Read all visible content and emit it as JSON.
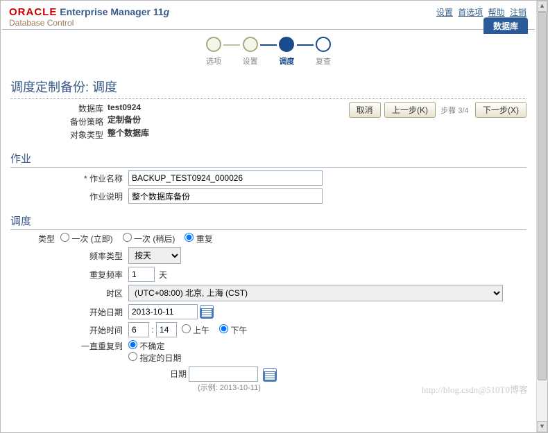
{
  "header": {
    "brand_oracle": "ORACLE",
    "brand_em": "Enterprise Manager 11",
    "brand_g": "g",
    "brand_sub": "Database Control",
    "links": {
      "settings": "设置",
      "prefs": "首选项",
      "help": "帮助",
      "logout": "注销"
    },
    "db_tab": "数据库"
  },
  "stepper": {
    "s1": "选项",
    "s2": "设置",
    "s3": "调度",
    "s4": "复查"
  },
  "page": {
    "title": "调度定制备份: 调度",
    "ctx": {
      "db_label": "数据库",
      "db_value": "test0924",
      "policy_label": "备份策略",
      "policy_value": "定制备份",
      "obj_label": "对象类型",
      "obj_value": "整个数据库"
    },
    "actions": {
      "cancel": "取消",
      "back": "上一步(K)",
      "step_text": "步骤 3/4",
      "next": "下一步(X)"
    }
  },
  "jobs": {
    "section": "作业",
    "name_label": "* 作业名称",
    "name_value": "BACKUP_TEST0924_000026",
    "desc_label": "作业说明",
    "desc_value": "整个数据库备份"
  },
  "sched": {
    "section": "调度",
    "type_label": "类型",
    "type_opts": {
      "once_now": "一次 (立即)",
      "once_later": "一次 (稍后)",
      "repeat": "重复"
    },
    "freq_type_label": "频率类型",
    "freq_type_value": "按天",
    "repeat_freq_label": "重复频率",
    "repeat_freq_value": "1",
    "repeat_freq_unit": "天",
    "tz_label": "时区",
    "tz_value": "(UTC+08:00) 北京, 上海  (CST)",
    "start_date_label": "开始日期",
    "start_date_value": "2013-10-11",
    "start_time_label": "开始时间",
    "start_h": "6",
    "start_m": "14",
    "am": "上午",
    "pm": "下午",
    "until_label": "一直重复到",
    "until_indef": "不确定",
    "until_date": "指定的日期",
    "until_date_label": "日期",
    "until_date_value": "",
    "until_hint": "(示例: 2013-10-11)"
  },
  "watermark": "http://blog.csdn@510T0博客"
}
